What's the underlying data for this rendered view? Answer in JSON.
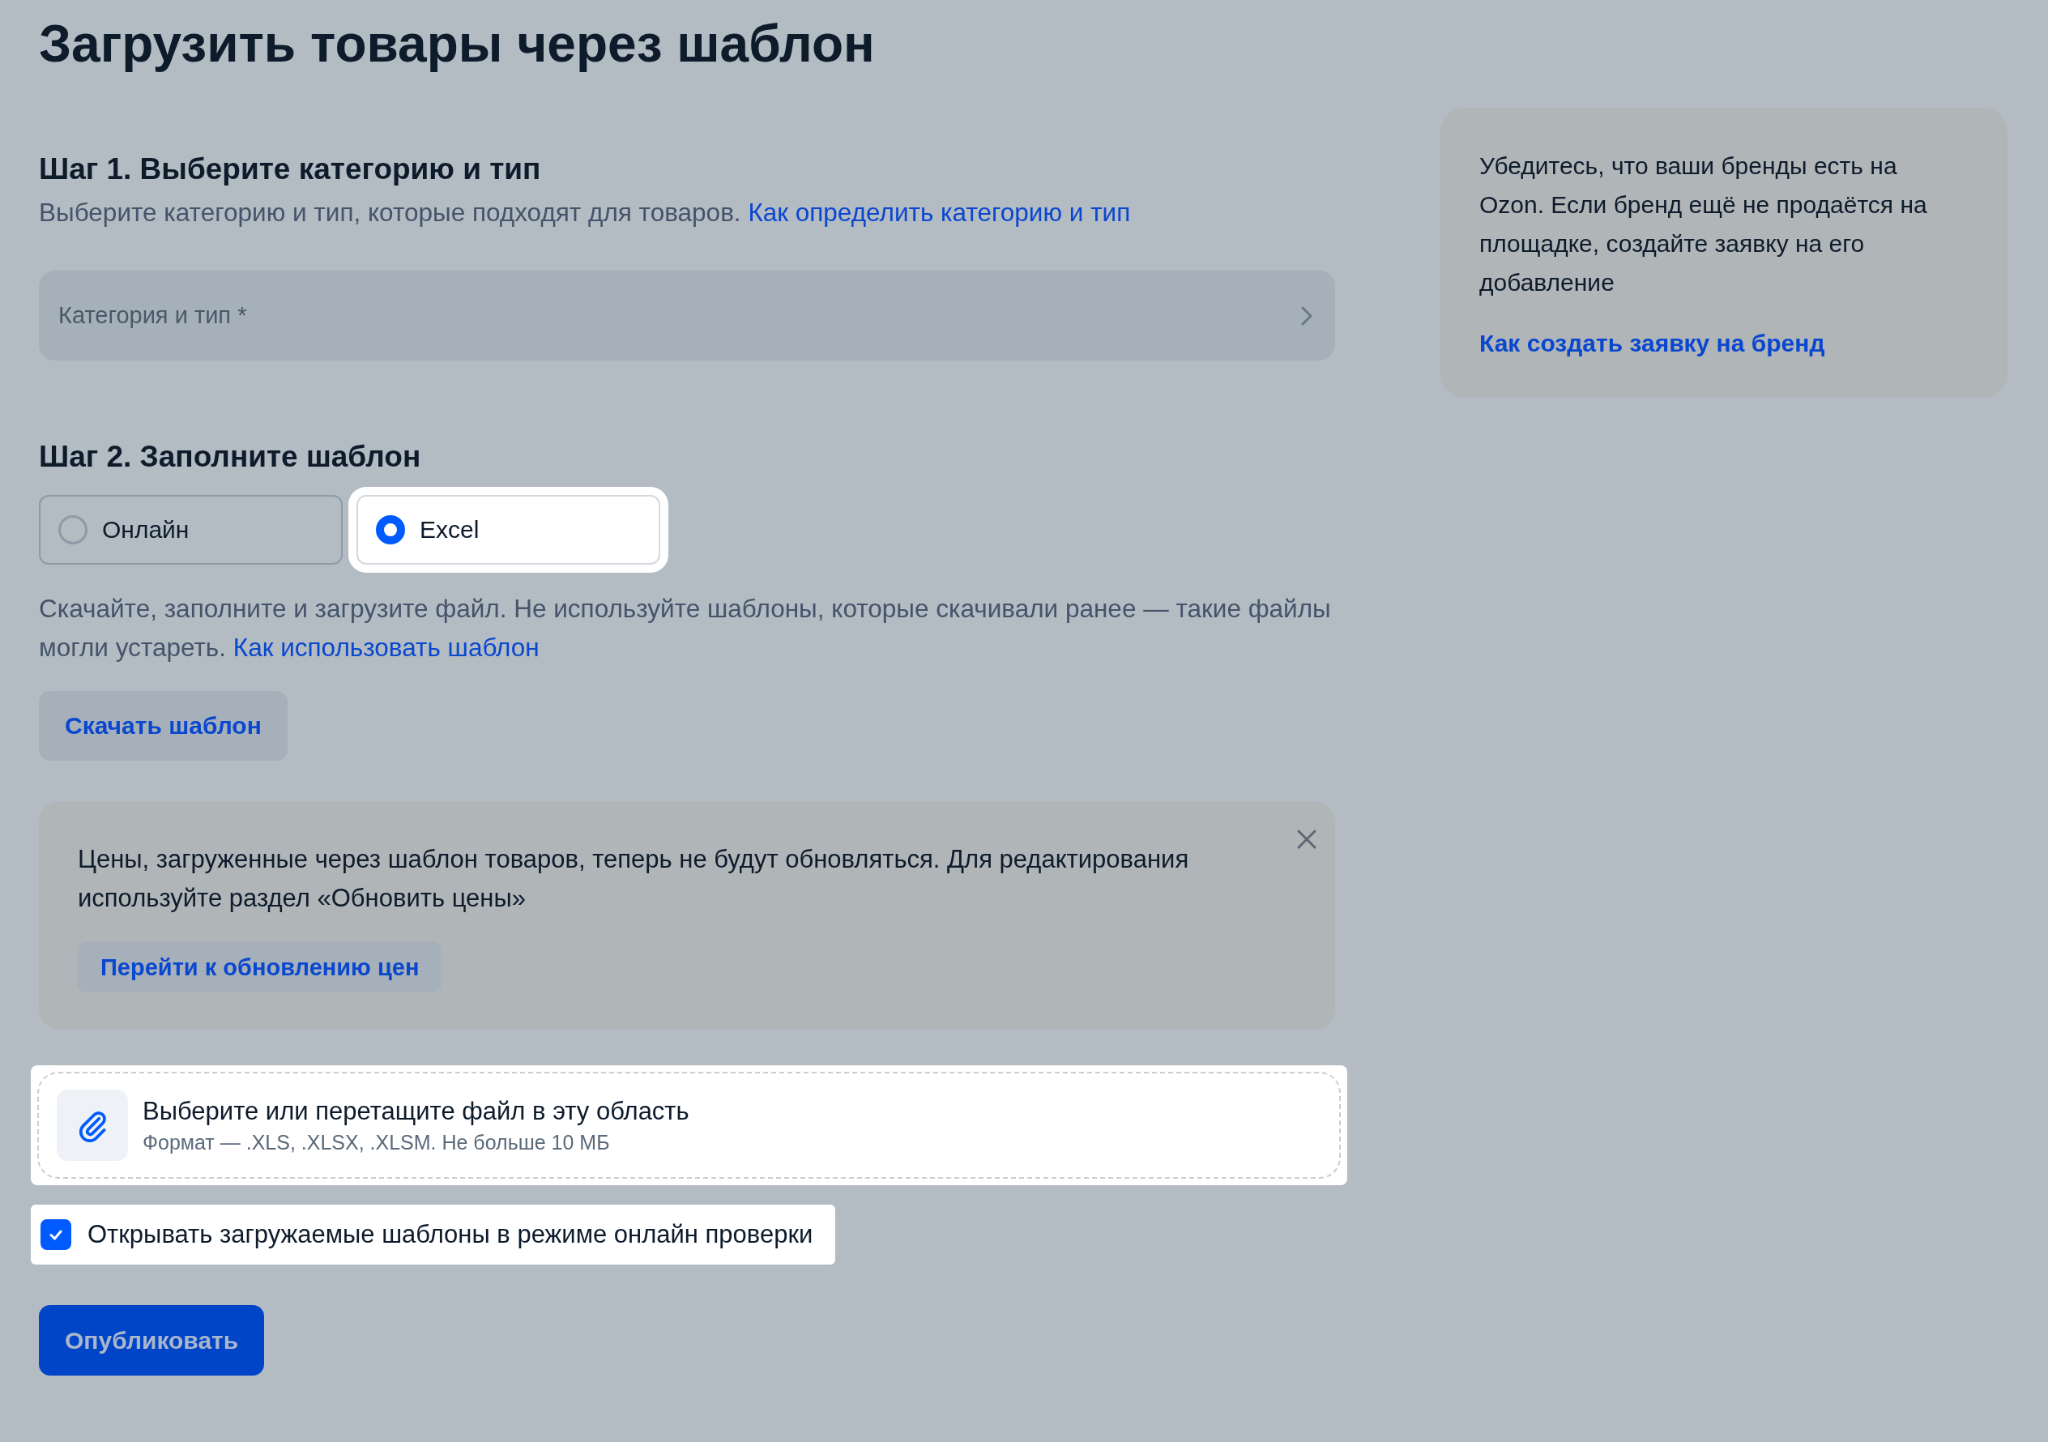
{
  "title": "Загрузить товары через шаблон",
  "step1": {
    "heading": "Шаг 1. Выберите категорию и тип",
    "description": "Выберите категорию и тип, которые подходят для товаров.",
    "link": "Как определить категорию и тип",
    "select_placeholder": "Категория и тип *"
  },
  "step2": {
    "heading": "Шаг 2. Заполните шаблон",
    "options": [
      {
        "label": "Онлайн",
        "selected": false
      },
      {
        "label": "Excel",
        "selected": true
      }
    ],
    "description": "Скачайте, заполните и загрузите файл. Не используйте шаблоны, которые скачивали ранее — такие файлы могли устареть.",
    "link": "Как использовать шаблон",
    "download_button": "Скачать шаблон"
  },
  "notice": {
    "text": "Цены, загруженные через шаблон товаров, теперь не будут обновляться. Для редактирования используйте раздел «Обновить цены»",
    "button": "Перейти к обновлению цен"
  },
  "upload": {
    "title": "Выберите или перетащите файл в эту область",
    "hint": "Формат — .XLS, .XLSX, .XLSM. Не больше 10 МБ"
  },
  "checkbox": {
    "label": "Открывать загружаемые шаблоны в режиме онлайн проверки",
    "checked": true
  },
  "publish_button": "Опубликовать",
  "side_card": {
    "text": "Убедитесь, что ваши бренды есть на Ozon. Если бренд ещё не продаётся на площадке, создайте заявку на его добавление",
    "link": "Как создать заявку на бренд"
  }
}
